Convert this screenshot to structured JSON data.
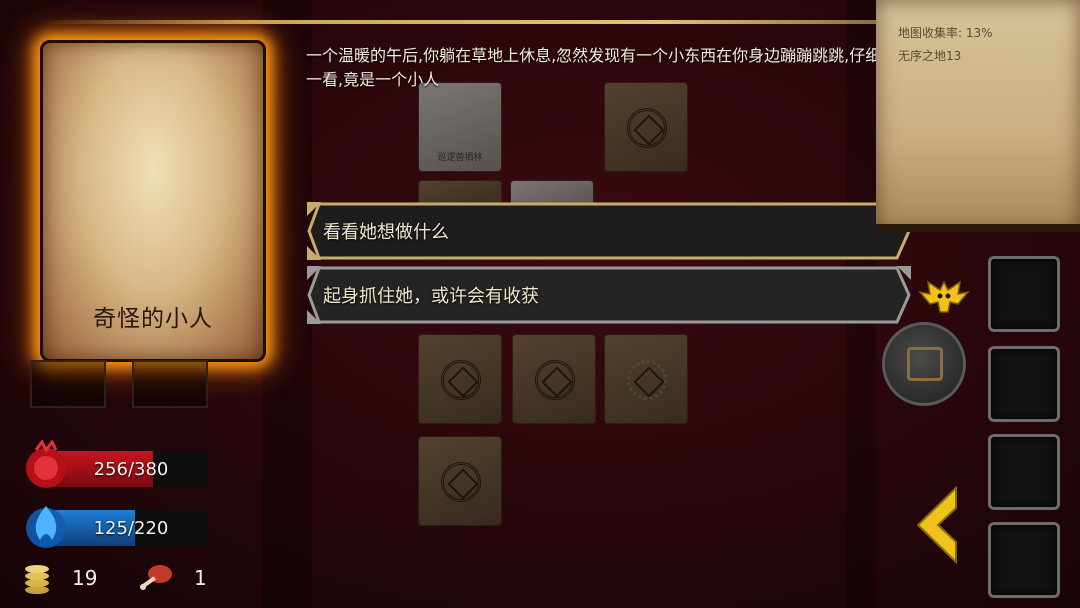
{
  "event": {
    "card_title": "奇怪的小人",
    "story_text": "一个温暖的午后,你躺在草地上休息,忽然发现有一个小东西在你身边蹦蹦跳跳,仔细一看,竟是一个小人"
  },
  "choices": [
    {
      "label": "看看她想做什么"
    },
    {
      "label": "起身抓住她，或许会有收获"
    }
  ],
  "map_panel": {
    "stat_1": "地图收集率: 13%",
    "stat_2": "无序之地13"
  },
  "board": {
    "tile_caption": "巡逻兽栖林"
  },
  "player": {
    "hp_text": "256/380",
    "hp_fraction": 0.674,
    "mp_text": "125/220",
    "mp_fraction": 0.568,
    "gold": "19",
    "food": "1"
  },
  "colors": {
    "hp": "#c8141c",
    "mp": "#1f7fd6",
    "card_glow": "#ff9a16",
    "choice_border": "#c7ad6c"
  },
  "icons": {
    "hp": "red-heart-orb-icon",
    "mp": "blue-flame-orb-icon",
    "gold": "coin-stack-icon",
    "food": "meat-icon",
    "dragon": "dragon-emblem-icon",
    "chest": "treasure-chest-icon",
    "back": "chevron-left-icon"
  }
}
